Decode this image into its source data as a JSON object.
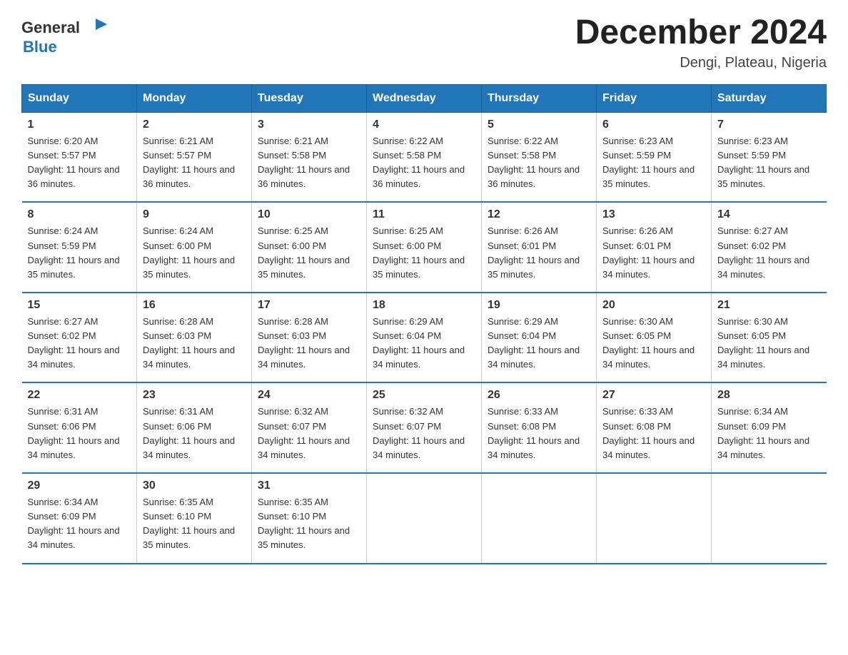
{
  "header": {
    "logo_general": "General",
    "logo_blue": "Blue",
    "month_title": "December 2024",
    "location": "Dengi, Plateau, Nigeria"
  },
  "days_of_week": [
    "Sunday",
    "Monday",
    "Tuesday",
    "Wednesday",
    "Thursday",
    "Friday",
    "Saturday"
  ],
  "weeks": [
    [
      {
        "day": "1",
        "sunrise": "6:20 AM",
        "sunset": "5:57 PM",
        "daylight": "11 hours and 36 minutes."
      },
      {
        "day": "2",
        "sunrise": "6:21 AM",
        "sunset": "5:57 PM",
        "daylight": "11 hours and 36 minutes."
      },
      {
        "day": "3",
        "sunrise": "6:21 AM",
        "sunset": "5:58 PM",
        "daylight": "11 hours and 36 minutes."
      },
      {
        "day": "4",
        "sunrise": "6:22 AM",
        "sunset": "5:58 PM",
        "daylight": "11 hours and 36 minutes."
      },
      {
        "day": "5",
        "sunrise": "6:22 AM",
        "sunset": "5:58 PM",
        "daylight": "11 hours and 36 minutes."
      },
      {
        "day": "6",
        "sunrise": "6:23 AM",
        "sunset": "5:59 PM",
        "daylight": "11 hours and 35 minutes."
      },
      {
        "day": "7",
        "sunrise": "6:23 AM",
        "sunset": "5:59 PM",
        "daylight": "11 hours and 35 minutes."
      }
    ],
    [
      {
        "day": "8",
        "sunrise": "6:24 AM",
        "sunset": "5:59 PM",
        "daylight": "11 hours and 35 minutes."
      },
      {
        "day": "9",
        "sunrise": "6:24 AM",
        "sunset": "6:00 PM",
        "daylight": "11 hours and 35 minutes."
      },
      {
        "day": "10",
        "sunrise": "6:25 AM",
        "sunset": "6:00 PM",
        "daylight": "11 hours and 35 minutes."
      },
      {
        "day": "11",
        "sunrise": "6:25 AM",
        "sunset": "6:00 PM",
        "daylight": "11 hours and 35 minutes."
      },
      {
        "day": "12",
        "sunrise": "6:26 AM",
        "sunset": "6:01 PM",
        "daylight": "11 hours and 35 minutes."
      },
      {
        "day": "13",
        "sunrise": "6:26 AM",
        "sunset": "6:01 PM",
        "daylight": "11 hours and 34 minutes."
      },
      {
        "day": "14",
        "sunrise": "6:27 AM",
        "sunset": "6:02 PM",
        "daylight": "11 hours and 34 minutes."
      }
    ],
    [
      {
        "day": "15",
        "sunrise": "6:27 AM",
        "sunset": "6:02 PM",
        "daylight": "11 hours and 34 minutes."
      },
      {
        "day": "16",
        "sunrise": "6:28 AM",
        "sunset": "6:03 PM",
        "daylight": "11 hours and 34 minutes."
      },
      {
        "day": "17",
        "sunrise": "6:28 AM",
        "sunset": "6:03 PM",
        "daylight": "11 hours and 34 minutes."
      },
      {
        "day": "18",
        "sunrise": "6:29 AM",
        "sunset": "6:04 PM",
        "daylight": "11 hours and 34 minutes."
      },
      {
        "day": "19",
        "sunrise": "6:29 AM",
        "sunset": "6:04 PM",
        "daylight": "11 hours and 34 minutes."
      },
      {
        "day": "20",
        "sunrise": "6:30 AM",
        "sunset": "6:05 PM",
        "daylight": "11 hours and 34 minutes."
      },
      {
        "day": "21",
        "sunrise": "6:30 AM",
        "sunset": "6:05 PM",
        "daylight": "11 hours and 34 minutes."
      }
    ],
    [
      {
        "day": "22",
        "sunrise": "6:31 AM",
        "sunset": "6:06 PM",
        "daylight": "11 hours and 34 minutes."
      },
      {
        "day": "23",
        "sunrise": "6:31 AM",
        "sunset": "6:06 PM",
        "daylight": "11 hours and 34 minutes."
      },
      {
        "day": "24",
        "sunrise": "6:32 AM",
        "sunset": "6:07 PM",
        "daylight": "11 hours and 34 minutes."
      },
      {
        "day": "25",
        "sunrise": "6:32 AM",
        "sunset": "6:07 PM",
        "daylight": "11 hours and 34 minutes."
      },
      {
        "day": "26",
        "sunrise": "6:33 AM",
        "sunset": "6:08 PM",
        "daylight": "11 hours and 34 minutes."
      },
      {
        "day": "27",
        "sunrise": "6:33 AM",
        "sunset": "6:08 PM",
        "daylight": "11 hours and 34 minutes."
      },
      {
        "day": "28",
        "sunrise": "6:34 AM",
        "sunset": "6:09 PM",
        "daylight": "11 hours and 34 minutes."
      }
    ],
    [
      {
        "day": "29",
        "sunrise": "6:34 AM",
        "sunset": "6:09 PM",
        "daylight": "11 hours and 34 minutes."
      },
      {
        "day": "30",
        "sunrise": "6:35 AM",
        "sunset": "6:10 PM",
        "daylight": "11 hours and 35 minutes."
      },
      {
        "day": "31",
        "sunrise": "6:35 AM",
        "sunset": "6:10 PM",
        "daylight": "11 hours and 35 minutes."
      },
      null,
      null,
      null,
      null
    ]
  ]
}
